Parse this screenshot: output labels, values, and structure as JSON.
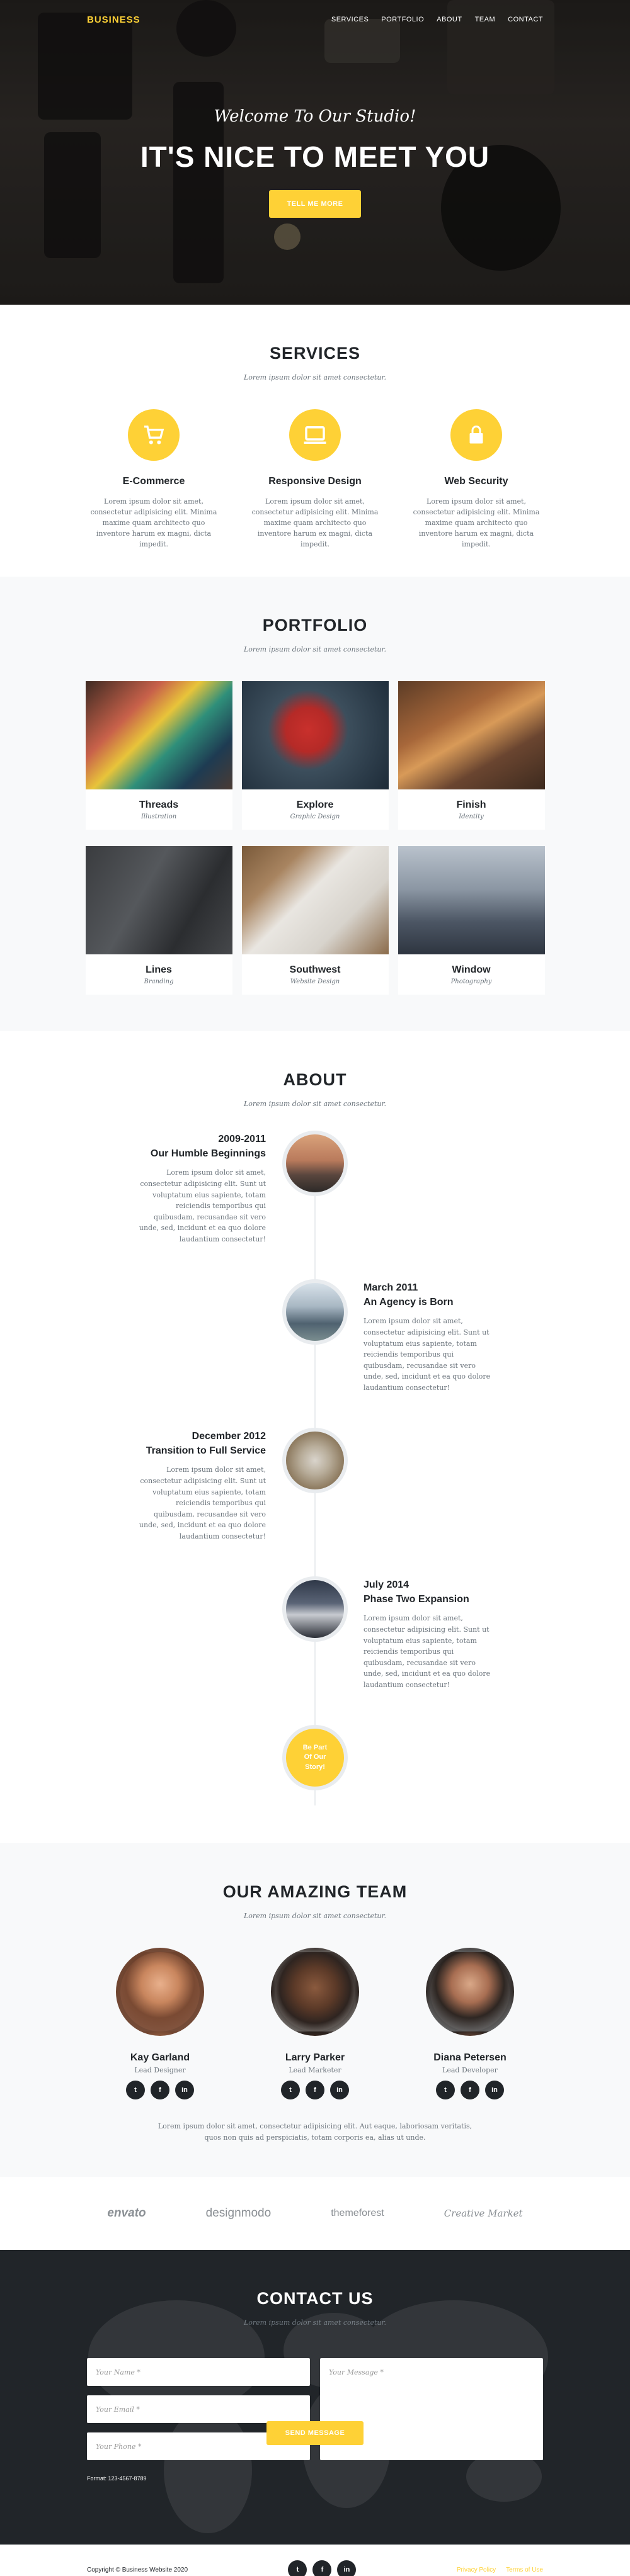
{
  "nav": {
    "brand": "BUSINESS",
    "links": [
      "SERVICES",
      "PORTFOLIO",
      "ABOUT",
      "TEAM",
      "CONTACT"
    ]
  },
  "hero": {
    "subtitle": "Welcome To Our Studio!",
    "title": "IT'S NICE TO MEET YOU",
    "button": "TELL ME MORE"
  },
  "services": {
    "title": "SERVICES",
    "subtitle": "Lorem ipsum dolor sit amet consectetur.",
    "items": [
      {
        "icon": "cart-icon",
        "title": "E-Commerce",
        "text": "Lorem ipsum dolor sit amet, consectetur adipisicing elit. Minima maxime quam architecto quo inventore harum ex magni, dicta impedit."
      },
      {
        "icon": "laptop-icon",
        "title": "Responsive Design",
        "text": "Lorem ipsum dolor sit amet, consectetur adipisicing elit. Minima maxime quam architecto quo inventore harum ex magni, dicta impedit."
      },
      {
        "icon": "lock-icon",
        "title": "Web Security",
        "text": "Lorem ipsum dolor sit amet, consectetur adipisicing elit. Minima maxime quam architecto quo inventore harum ex magni, dicta impedit."
      }
    ]
  },
  "portfolio": {
    "title": "PORTFOLIO",
    "subtitle": "Lorem ipsum dolor sit amet consectetur.",
    "items": [
      {
        "title": "Threads",
        "category": "Illustration"
      },
      {
        "title": "Explore",
        "category": "Graphic Design"
      },
      {
        "title": "Finish",
        "category": "Identity"
      },
      {
        "title": "Lines",
        "category": "Branding"
      },
      {
        "title": "Southwest",
        "category": "Website Design"
      },
      {
        "title": "Window",
        "category": "Photography"
      }
    ]
  },
  "about": {
    "title": "ABOUT",
    "subtitle": "Lorem ipsum dolor sit amet consectetur.",
    "timeline": [
      {
        "date": "2009-2011",
        "heading": "Our Humble Beginnings",
        "text": "Lorem ipsum dolor sit amet, consectetur adipisicing elit. Sunt ut voluptatum eius sapiente, totam reiciendis temporibus qui quibusdam, recusandae sit vero unde, sed, incidunt et ea quo dolore laudantium consectetur!"
      },
      {
        "date": "March 2011",
        "heading": "An Agency is Born",
        "text": "Lorem ipsum dolor sit amet, consectetur adipisicing elit. Sunt ut voluptatum eius sapiente, totam reiciendis temporibus qui quibusdam, recusandae sit vero unde, sed, incidunt et ea quo dolore laudantium consectetur!"
      },
      {
        "date": "December 2012",
        "heading": "Transition to Full Service",
        "text": "Lorem ipsum dolor sit amet, consectetur adipisicing elit. Sunt ut voluptatum eius sapiente, totam reiciendis temporibus qui quibusdam, recusandae sit vero unde, sed, incidunt et ea quo dolore laudantium consectetur!"
      },
      {
        "date": "July 2014",
        "heading": "Phase Two Expansion",
        "text": "Lorem ipsum dolor sit amet, consectetur adipisicing elit. Sunt ut voluptatum eius sapiente, totam reiciendis temporibus qui quibusdam, recusandae sit vero unde, sed, incidunt et ea quo dolore laudantium consectetur!"
      }
    ],
    "end_line1": "Be Part",
    "end_line2": "Of Our",
    "end_line3": "Story!"
  },
  "team": {
    "title": "OUR AMAZING TEAM",
    "subtitle": "Lorem ipsum dolor sit amet consectetur.",
    "members": [
      {
        "name": "Kay Garland",
        "role": "Lead Designer"
      },
      {
        "name": "Larry Parker",
        "role": "Lead Marketer"
      },
      {
        "name": "Diana Petersen",
        "role": "Lead Developer"
      }
    ],
    "social_icons": [
      "twitter-icon",
      "facebook-icon",
      "linkedin-icon"
    ],
    "text": "Lorem ipsum dolor sit amet, consectetur adipisicing elit. Aut eaque, laboriosam veritatis, quos non quis ad perspiciatis, totam corporis ea, alias ut unde."
  },
  "clients": [
    "envato",
    "designmodo",
    "themeforest",
    "Creative Market"
  ],
  "contact": {
    "title": "CONTACT US",
    "subtitle": "Lorem ipsum dolor sit amet consectetur.",
    "name_placeholder": "Your Name *",
    "email_placeholder": "Your Email *",
    "phone_placeholder": "Your Phone *",
    "message_placeholder": "Your Message *",
    "note": "Format: 123-4567-8789",
    "button": "SEND MESSAGE"
  },
  "footer": {
    "copyright": "Copyright © Business Website 2020",
    "privacy": "Privacy Policy",
    "terms": "Terms of Use"
  },
  "colors": {
    "accent": "#fed136",
    "dark": "#212529",
    "muted": "#6c757d"
  }
}
